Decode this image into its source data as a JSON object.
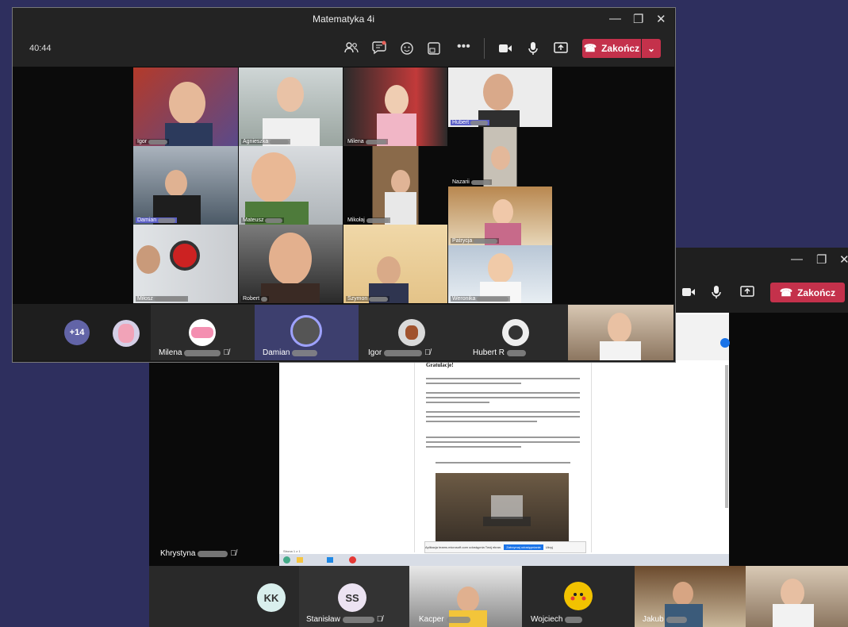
{
  "front_window": {
    "title": "Matematyka 4i",
    "timer": "40:44",
    "end_label": "Zakończ",
    "grid": [
      {
        "name": "Igor"
      },
      {
        "name": "Agnieszka"
      },
      {
        "name": "Milena"
      },
      {
        "name": "Hubert"
      },
      {
        "name": "Nazarii"
      },
      {
        "name": "Damian"
      },
      {
        "name": "Mateusz"
      },
      {
        "name": "Mikołaj"
      },
      {
        "name": "Patrycja"
      },
      {
        "name": "Miłosz"
      },
      {
        "name": "Robert"
      },
      {
        "name": "Szymon"
      },
      {
        "name": "Weronika"
      }
    ],
    "more_count": "+14",
    "strip": [
      {
        "name": "Milena"
      },
      {
        "name": "Damian"
      },
      {
        "name": "Igor"
      },
      {
        "name": "Hubert R"
      }
    ]
  },
  "back_window": {
    "end_label": "Zakończ",
    "presenter": "Khrystyna",
    "document": {
      "heading": "Gratulacje!",
      "notification": "Aplikacja teams.microsoft.com udostępnia Twój ekran.",
      "share_button": "Zatrzymaj udostępnianie",
      "hide_button": "Ukryj",
      "page_info": "Strona 1 z 1"
    },
    "strip": [
      {
        "initials": "KK",
        "name": ""
      },
      {
        "initials": "SS",
        "name": "Stanisław"
      },
      {
        "initials": "",
        "name": "Kacper"
      },
      {
        "initials": "",
        "name": "Wojciech"
      },
      {
        "initials": "",
        "name": "Jakub"
      },
      {
        "initials": "",
        "name": ""
      }
    ]
  },
  "colors": {
    "end_red": "#c4314b",
    "accent": "#6264a7",
    "background": "#2e2f5e"
  }
}
